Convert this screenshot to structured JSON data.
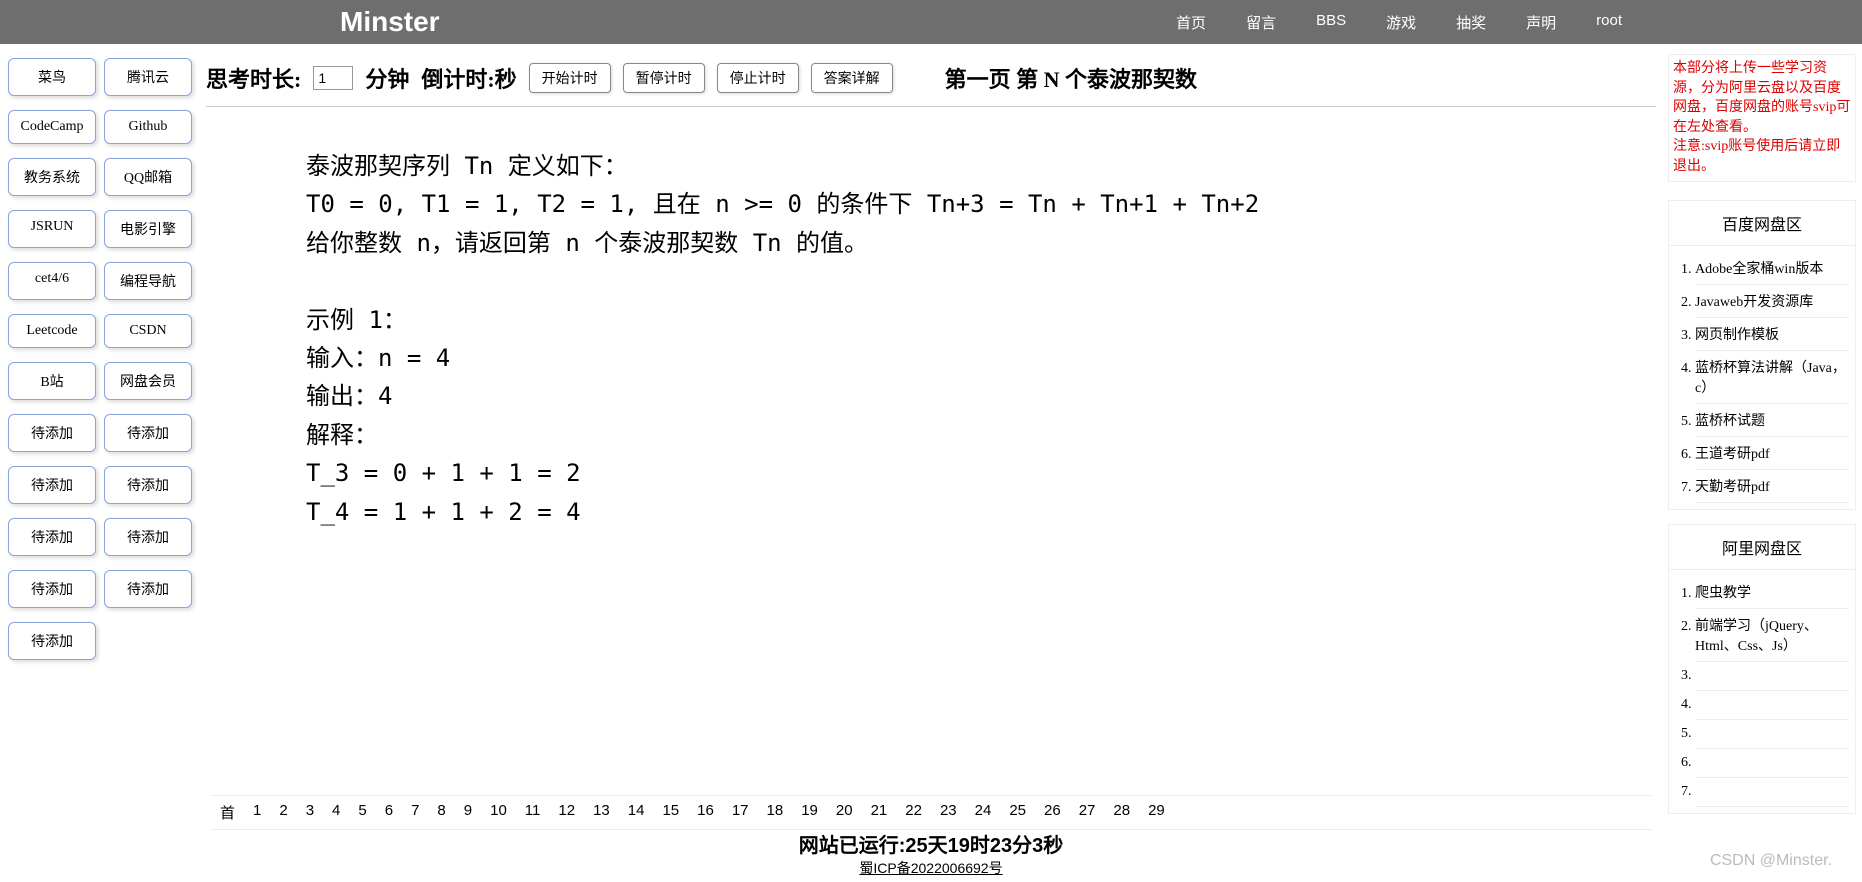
{
  "brand": "Minster",
  "nav": [
    "首页",
    "留言",
    "BBS",
    "游戏",
    "抽奖",
    "声明",
    "root"
  ],
  "left_buttons": [
    "菜鸟",
    "腾讯云",
    "CodeCamp",
    "Github",
    "教务系统",
    "QQ邮箱",
    "JSRUN",
    "电影引擎",
    "cet4/6",
    "编程导航",
    "Leetcode",
    "CSDN",
    "B站",
    "网盘会员",
    "待添加",
    "待添加",
    "待添加",
    "待添加",
    "待添加",
    "待添加",
    "待添加",
    "待添加",
    "待添加"
  ],
  "toolbar": {
    "think_label": "思考时长:",
    "think_value": "1",
    "minute_label": "分钟",
    "countdown_label": "倒计时:秒",
    "buttons": [
      "开始计时",
      "暂停计时",
      "停止计时",
      "答案详解"
    ],
    "page_title": "第一页  第 N 个泰波那契数"
  },
  "problem_text": "泰波那契序列 Tn 定义如下：\nT0 = 0, T1 = 1, T2 = 1, 且在 n >= 0 的条件下 Tn+3 = Tn + Tn+1 + Tn+2\n给你整数 n，请返回第 n 个泰波那契数 Tn 的值。\n\n示例 1：\n输入：n = 4\n输出：4\n解释：\nT_3 = 0 + 1 + 1 = 2\nT_4 = 1 + 1 + 2 = 4",
  "pager": [
    "首",
    "1",
    "2",
    "3",
    "4",
    "5",
    "6",
    "7",
    "8",
    "9",
    "10",
    "11",
    "12",
    "13",
    "14",
    "15",
    "16",
    "17",
    "18",
    "19",
    "20",
    "21",
    "22",
    "23",
    "24",
    "25",
    "26",
    "27",
    "28",
    "29"
  ],
  "runtime": "网站已运行:25天19时23分3秒",
  "icp": "蜀ICP备2022006692号",
  "notice": "本部分将上传一些学习资源，分为阿里云盘以及百度网盘，百度网盘的账号svip可在左处查看。\n注意:svip账号使用后请立即退出。",
  "baidu": {
    "title": "百度网盘区",
    "items": [
      "Adobe全家桶win版本",
      "Javaweb开发资源库",
      "网页制作模板",
      "蓝桥杯算法讲解（Java，c）",
      "蓝桥杯试题",
      "王道考研pdf",
      "天勤考研pdf"
    ]
  },
  "ali": {
    "title": "阿里网盘区",
    "items": [
      "爬虫教学",
      "前端学习（jQuery、Html、Css、Js）",
      "",
      "",
      "",
      "",
      ""
    ]
  },
  "watermark": "CSDN @Minster."
}
